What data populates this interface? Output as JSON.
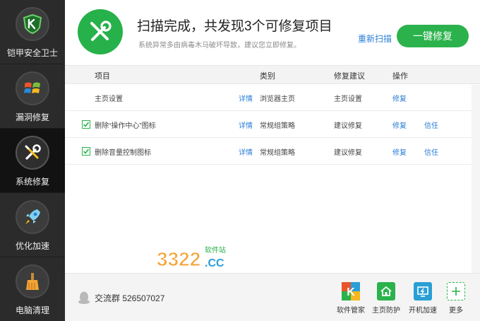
{
  "sidebar": {
    "items": [
      {
        "label": "铠甲安全卫士",
        "icon": "shield-logo-icon"
      },
      {
        "label": "漏洞修复",
        "icon": "windows-logo-icon"
      },
      {
        "label": "系统修复",
        "icon": "wrench-screwdriver-icon"
      },
      {
        "label": "优化加速",
        "icon": "rocket-icon"
      },
      {
        "label": "电脑清理",
        "icon": "broom-icon"
      }
    ],
    "active": "系统修复"
  },
  "window_buttons": {
    "feedback": "feedback-icon",
    "menu": "menu-icon",
    "minimize": "minimize-icon",
    "close": "close-icon"
  },
  "header": {
    "title": "扫描完成，共发现3个可修复项目",
    "subtitle": "系统异常多由病毒木马破坏导致，建议您立即修复。",
    "rescan_label": "重新扫描",
    "fix_all_label": "一键修复",
    "accent_color": "#27b14a"
  },
  "table": {
    "columns": {
      "item": "项目",
      "category": "类别",
      "suggestion": "修复建议",
      "action": "操作"
    },
    "rows": [
      {
        "checked": false,
        "show_checkbox": false,
        "item": "主页设置",
        "detail": "详情",
        "category": "浏览器主页",
        "suggestion": "主页设置",
        "fix": "修复",
        "trust": ""
      },
      {
        "checked": true,
        "show_checkbox": true,
        "item": "删除“操作中心”图标",
        "detail": "详情",
        "category": "常规组策略",
        "suggestion": "建议修复",
        "fix": "修复",
        "trust": "信任"
      },
      {
        "checked": true,
        "show_checkbox": true,
        "item": "删除音量控制图标",
        "detail": "详情",
        "category": "常规组策略",
        "suggestion": "建议修复",
        "fix": "修复",
        "trust": "信任"
      }
    ]
  },
  "watermark": {
    "text": "3322",
    "sub": "软件站",
    "domain": ".CC"
  },
  "footer": {
    "qq_group": "交流群 526507027",
    "tools": [
      {
        "label": "软件管家",
        "icon": "software-manager-icon",
        "color": "#e8552c"
      },
      {
        "label": "主页防护",
        "icon": "home-protect-icon",
        "color": "#2bb24c"
      },
      {
        "label": "开机加速",
        "icon": "boot-accelerate-icon",
        "color": "#2a9fd6"
      },
      {
        "label": "更多",
        "icon": "plus-icon",
        "color": "#2bb24c"
      }
    ]
  }
}
